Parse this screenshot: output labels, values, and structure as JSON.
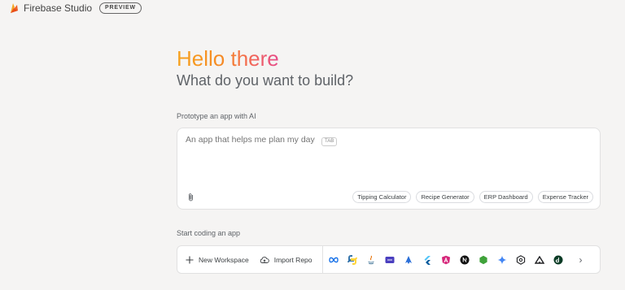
{
  "header": {
    "brand": "Firebase Studio",
    "badge": "PREVIEW"
  },
  "hero": {
    "greeting": "Hello there",
    "subtitle": "What do you want to build?"
  },
  "prototype": {
    "label": "Prototype an app with AI",
    "placeholder": "An app that helps me plan my day",
    "tab_hint": "TAB",
    "suggestions": [
      "Tipping Calculator",
      "Recipe Generator",
      "ERP Dashboard",
      "Expense Tracker"
    ]
  },
  "coding": {
    "label": "Start coding an app",
    "new_workspace": "New Workspace",
    "import_repo": "Import Repo",
    "templates": [
      "flutter-infinity-icon",
      "python-icon",
      "java-icon",
      "dart-icon",
      "astro-icon",
      "flutter-icon",
      "angular-icon",
      "nextjs-icon",
      "nodejs-icon",
      "gemini-icon",
      "go-icon",
      "nuxt-icon",
      "django-icon"
    ]
  },
  "colors": {
    "background": "#f5f4f3",
    "gradient_start": "#f7a21d",
    "gradient_end": "#e64a8a"
  }
}
